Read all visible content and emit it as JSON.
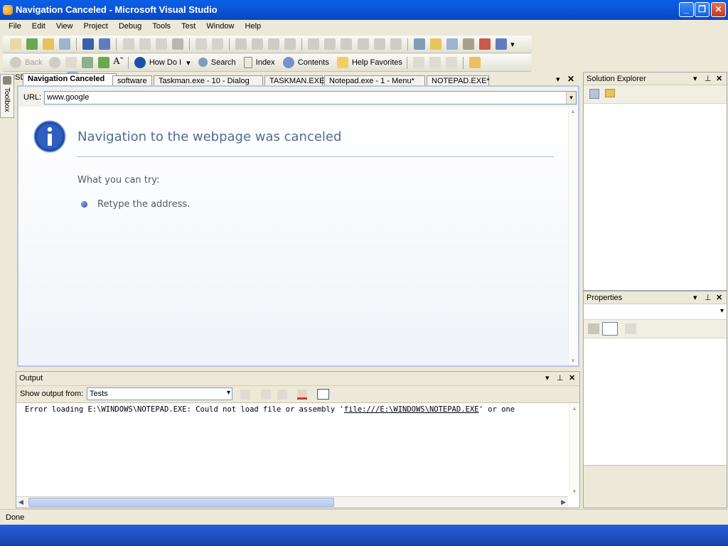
{
  "window": {
    "title": "Navigation Canceled - Microsoft Visual Studio"
  },
  "menu": [
    "File",
    "Edit",
    "View",
    "Project",
    "Debug",
    "Tools",
    "Test",
    "Window",
    "Help"
  ],
  "webtoolbar": {
    "back": "Back",
    "how_do_i": "How Do I",
    "search": "Search",
    "index": "Index",
    "contents": "Contents",
    "help_favorites": "Help Favorites",
    "msdn_forums": "MSDN Forums"
  },
  "toolbox": {
    "label": "Toolbox"
  },
  "tabs": [
    "Navigation Canceled",
    "software",
    "Taskman.exe - 10 - Dialog",
    "TASKMAN.EXE",
    "Notepad.exe - 1 - Menu*",
    "NOTEPAD.EXE*"
  ],
  "browser": {
    "url_label": "URL:",
    "url_value": "www.google",
    "heading": "Navigation to the webpage was canceled",
    "subheading": "What you can try:",
    "suggestion": "Retype the address."
  },
  "solution_explorer": {
    "title": "Solution Explorer"
  },
  "properties": {
    "title": "Properties"
  },
  "output": {
    "title": "Output",
    "show_label": "Show output from:",
    "source": "Tests",
    "text_prefix": "Error loading E:\\WINDOWS\\NOTEPAD.EXE: Could not load file or assembly '",
    "text_link": "file:///E:\\WINDOWS\\NOTEPAD.EXE",
    "text_suffix": "' or one"
  },
  "status": {
    "text": "Done"
  },
  "colors": {
    "titlebar": "#0b57d8",
    "heading": "#4f6b95",
    "info_icon": "#1e4fa8"
  }
}
